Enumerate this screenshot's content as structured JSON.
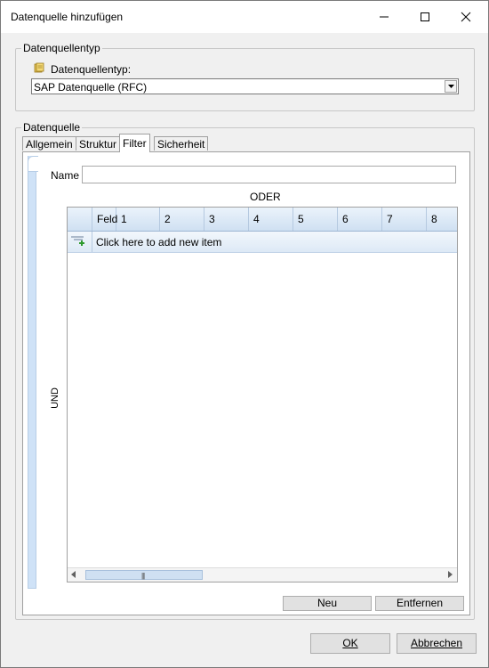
{
  "window": {
    "title": "Datenquelle hinzufügen"
  },
  "source_type_group": {
    "legend": "Datenquellentyp",
    "label": "Datenquellentyp:",
    "selected": "SAP Datenquelle (RFC)",
    "icon": "database-icon"
  },
  "datasource_group": {
    "legend": "Datenquelle",
    "tabs": [
      "Allgemein",
      "Struktur",
      "Filter",
      "Sicherheit"
    ],
    "active_tab": "Filter"
  },
  "filter": {
    "name_label": "Name",
    "name_value": "",
    "or_label": "ODER",
    "and_label": "UND",
    "columns": [
      "Feld",
      "1",
      "2",
      "3",
      "4",
      "5",
      "6",
      "7",
      "8"
    ],
    "add_row_text": "Click here to add new item",
    "new_button": "Neu",
    "remove_button": "Entfernen"
  },
  "footer": {
    "ok": "OK",
    "cancel": "Abbrechen"
  },
  "colors": {
    "grid_header": "#cfe0f2",
    "accent_strip": "#cfe2f7"
  }
}
